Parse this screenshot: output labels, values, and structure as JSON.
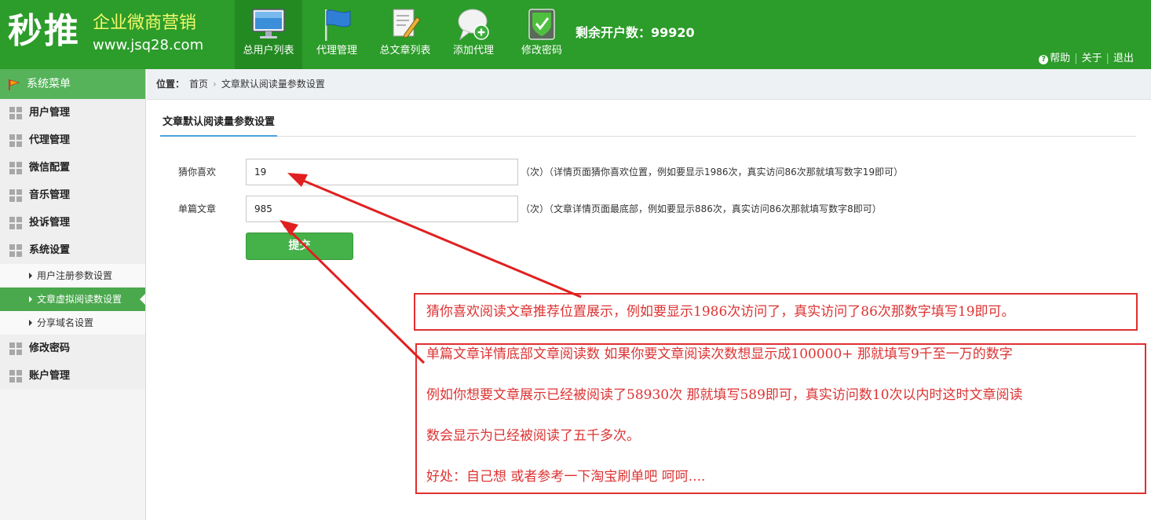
{
  "header": {
    "logo_main": "秒推",
    "logo_tagline": "企业微商营销",
    "logo_url": "www.jsq28.com",
    "nav": [
      {
        "label": "总用户列表",
        "icon": "monitor-icon",
        "active": true
      },
      {
        "label": "代理管理",
        "icon": "flag-icon",
        "active": false
      },
      {
        "label": "总文章列表",
        "icon": "document-edit-icon",
        "active": false
      },
      {
        "label": "添加代理",
        "icon": "chat-add-icon",
        "active": false
      },
      {
        "label": "修改密码",
        "icon": "shield-check-icon",
        "active": false
      }
    ],
    "remaining_label": "剩余开户数：",
    "remaining_count": "99920",
    "links": {
      "help": "帮助",
      "about": "关于",
      "logout": "退出"
    }
  },
  "sidebar": {
    "title": "系统菜单",
    "menu": [
      {
        "label": "用户管理"
      },
      {
        "label": "代理管理"
      },
      {
        "label": "微信配置"
      },
      {
        "label": "音乐管理"
      },
      {
        "label": "投诉管理"
      },
      {
        "label": "系统设置"
      }
    ],
    "submenu": [
      {
        "label": "用户注册参数设置",
        "active": false
      },
      {
        "label": "文章虚拟阅读数设置",
        "active": true
      },
      {
        "label": "分享域名设置",
        "active": false
      }
    ],
    "menu_after": [
      {
        "label": "修改密码"
      },
      {
        "label": "账户管理"
      }
    ]
  },
  "breadcrumb": {
    "prefix": "位置：",
    "home": "首页",
    "separator": "›",
    "current": "文章默认阅读量参数设置"
  },
  "form": {
    "section_title": "文章默认阅读量参数设置",
    "fields": [
      {
        "label": "猜你喜欢",
        "value": "19",
        "hint": "（次）（详情页面猜你喜欢位置，例如要显示1986次，真实访问86次那就填写数字19即可）"
      },
      {
        "label": "单篇文章",
        "value": "985",
        "hint": "（次）（文章详情页面最底部，例如要显示886次，真实访问86次那就填写数字8即可）"
      }
    ],
    "submit_label": "提交"
  },
  "annotations": {
    "box1": "猜你喜欢阅读文章推荐位置展示，例如要显示1986次访问了，真实访问了86次那数字填写19即可。",
    "box2": [
      "单篇文章详情底部文章阅读数 如果你要文章阅读次数想显示成100000+ 那就填写9千至一万的数字",
      "例如你想要文章展示已经被阅读了58930次 那就填写589即可，真实访问数10次以内时这时文章阅读",
      "数会显示为已经被阅读了五千多次。",
      "好处：自己想  或者参考一下淘宝刷单吧 呵呵...."
    ]
  },
  "colors": {
    "header_green": "#2c9c2a",
    "sidebar_title_green": "#56b35a",
    "active_green": "#4aa84d",
    "annotation_red": "#e03030",
    "logo_tagline_yellow": "#f3f96b"
  }
}
